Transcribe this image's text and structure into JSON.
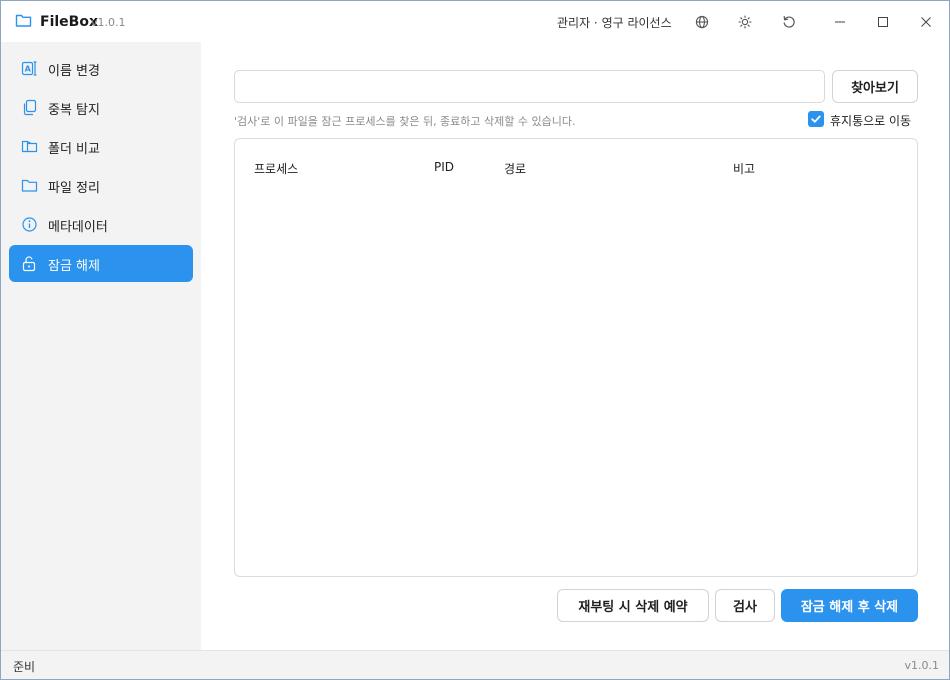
{
  "titlebar": {
    "app_name": "FileBox",
    "version": "v1.0.1",
    "license": "관리자 · 영구 라이선스",
    "icons": [
      "folder-icon",
      "globe-icon",
      "sun-icon",
      "undo-icon",
      "minimize-icon",
      "maximize-icon",
      "close-icon"
    ]
  },
  "sidebar": {
    "items": [
      {
        "label": "이름 변경",
        "icon": "rename-icon"
      },
      {
        "label": "중복 탐지",
        "icon": "duplicate-icon"
      },
      {
        "label": "폴더 비교",
        "icon": "folder-compare-icon"
      },
      {
        "label": "파일 정리",
        "icon": "folder-icon"
      },
      {
        "label": "메타데이터",
        "icon": "info-icon"
      },
      {
        "label": "잠금 해제",
        "icon": "unlock-icon",
        "active": true
      }
    ]
  },
  "main": {
    "path_value": "",
    "browse_label": "찾아보기",
    "hint": "'검사'로 이 파일을 잠근 프로세스를 찾은 뒤, 종료하고 삭제할 수 있습니다.",
    "recycle_label": "휴지통으로 이동",
    "recycle_checked": true,
    "table": {
      "columns": [
        "프로세스",
        "PID",
        "경로",
        "비고"
      ],
      "rows": []
    },
    "buttons": {
      "schedule_delete": "재부팅 시 삭제 예약",
      "scan": "검사",
      "unlock_delete": "잠금 해제 후 삭제"
    }
  },
  "statusbar": {
    "status": "준비",
    "version": "v1.0.1"
  },
  "colors": {
    "accent": "#2b93ee",
    "sidebar_bg": "#f3f3f3"
  }
}
